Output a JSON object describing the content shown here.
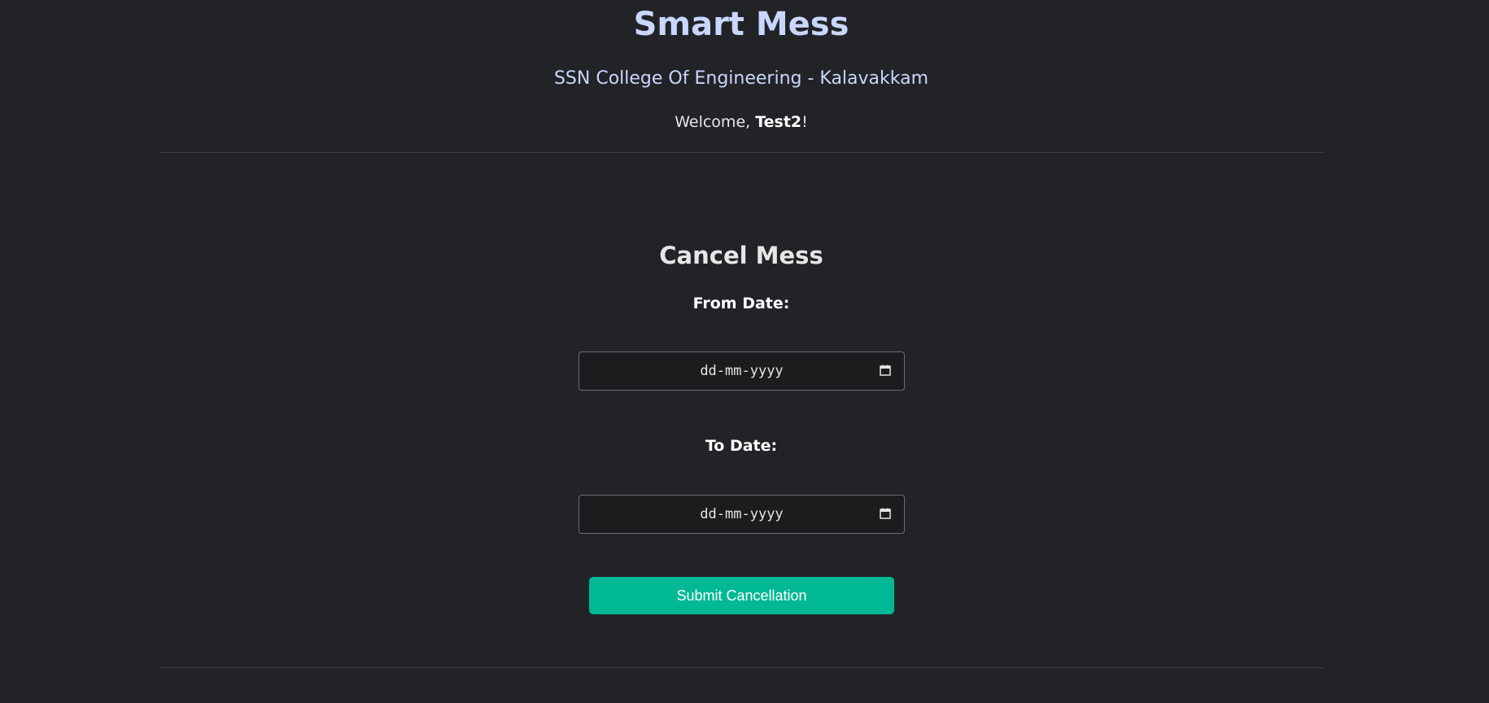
{
  "header": {
    "title": "Smart Mess",
    "college": "SSN College Of Engineering - Kalavakkam",
    "welcome_prefix": "Welcome, ",
    "username": "Test2",
    "welcome_suffix": "!"
  },
  "cancel_form": {
    "title": "Cancel Mess",
    "from_label": "From Date:",
    "from_value": "",
    "from_placeholder": "dd-mm-yyyy",
    "to_label": "To Date:",
    "to_value": "",
    "to_placeholder": "dd-mm-yyyy",
    "submit_label": "Submit Cancellation"
  },
  "icons": {
    "date_picker": "calendar-icon"
  },
  "colors": {
    "background": "#212326",
    "title": "#c9d6ff",
    "accent": "#00b894",
    "input_background": "#1b1c1e"
  }
}
